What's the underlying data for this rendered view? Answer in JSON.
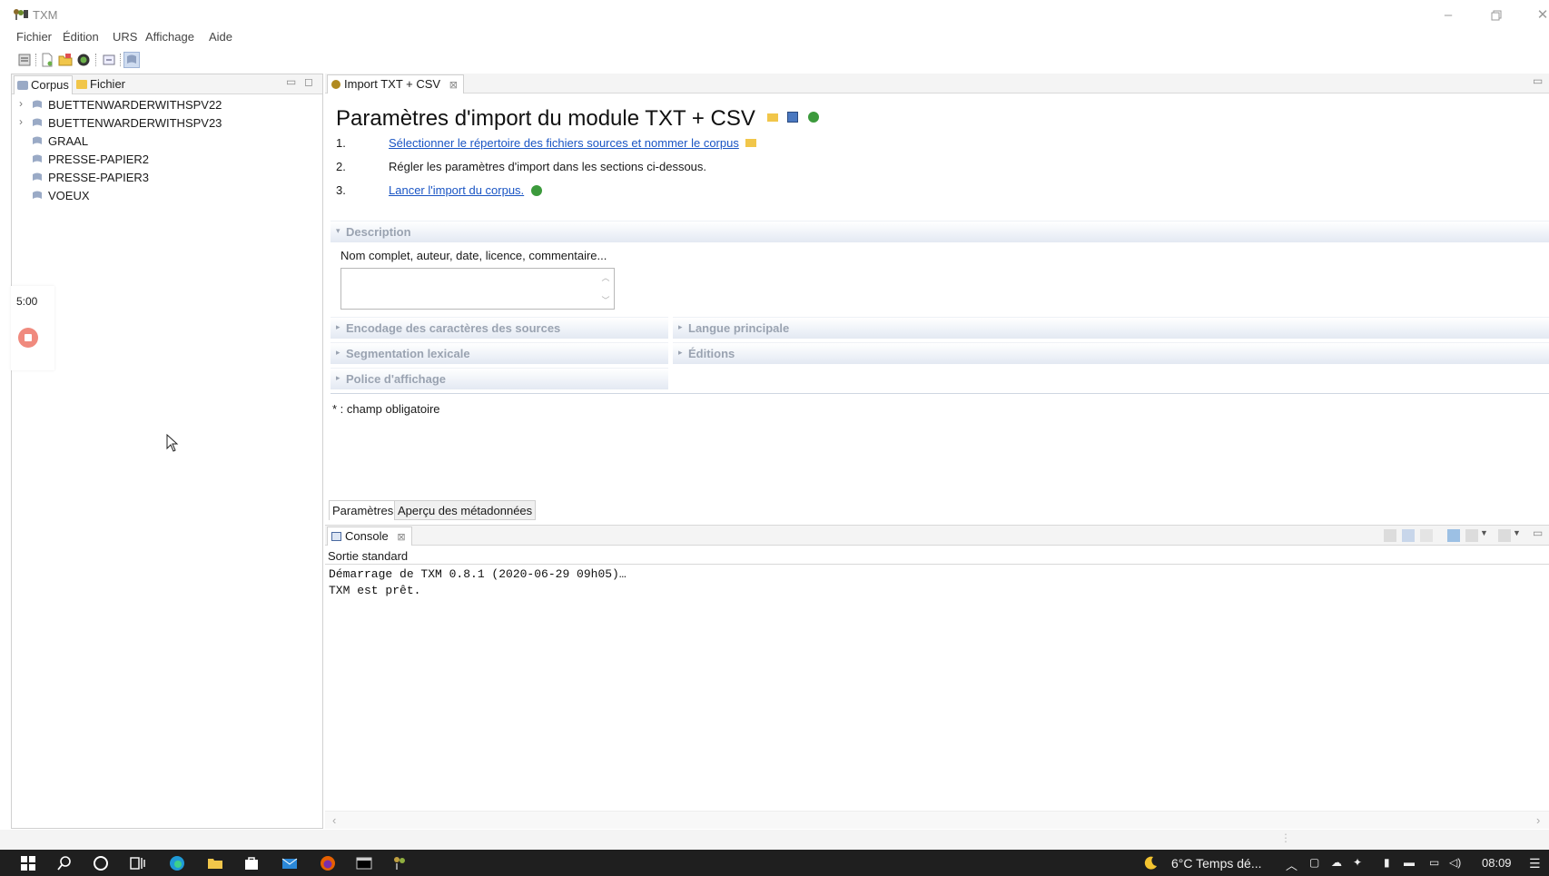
{
  "window": {
    "title": "TXM",
    "controls": [
      "minimize",
      "restore",
      "close"
    ]
  },
  "menu": {
    "items": [
      "Fichier",
      "Édition",
      "URS",
      "Affichage",
      "Aide"
    ]
  },
  "left_panel": {
    "tabs": [
      "Corpus",
      "Fichier"
    ],
    "corpora": [
      {
        "label": "BUETTENWARDERWITHSPV22",
        "expandable": true
      },
      {
        "label": "BUETTENWARDERWITHSPV23",
        "expandable": true
      },
      {
        "label": "GRAAL",
        "expandable": false
      },
      {
        "label": "PRESSE-PAPIER2",
        "expandable": false
      },
      {
        "label": "PRESSE-PAPIER3",
        "expandable": false
      },
      {
        "label": "VOEUX",
        "expandable": false
      }
    ]
  },
  "recorder": {
    "time": "5:00"
  },
  "editor": {
    "tab_label": "Import TXT + CSV",
    "title": "Paramètres d'import du module TXT + CSV",
    "steps": [
      {
        "num": "1.",
        "text": "Sélectionner le répertoire des fichiers sources et nommer le corpus",
        "link": true
      },
      {
        "num": "2.",
        "text": "Régler les paramètres d'import dans les sections ci-dessous.",
        "link": false
      },
      {
        "num": "3.",
        "text": "Lancer l'import du corpus.",
        "link": true
      }
    ],
    "description": {
      "header": "Description",
      "label": "Nom complet, auteur, date, licence, commentaire...",
      "value": ""
    },
    "sections_left": [
      "Encodage des caractères des sources",
      "Segmentation lexicale",
      "Police d'affichage"
    ],
    "sections_right": [
      "Langue principale",
      "Éditions"
    ],
    "required_note": "* : champ obligatoire",
    "bottom_tabs": [
      "Paramètres",
      "Aperçu des métadonnées"
    ]
  },
  "console": {
    "tab_label": "Console",
    "subtitle": "Sortie standard",
    "lines": [
      "Démarrage de TXM 0.8.1 (2020-06-29 09h05)…",
      "TXM est prêt."
    ]
  },
  "taskbar": {
    "weather": "6°C  Temps dé...",
    "time": "08:09"
  },
  "colors": {
    "link": "#1a55c4",
    "section_text": "#9aa3b1",
    "taskbar": "#1f1f1f",
    "record_button": "#f08a7e"
  }
}
